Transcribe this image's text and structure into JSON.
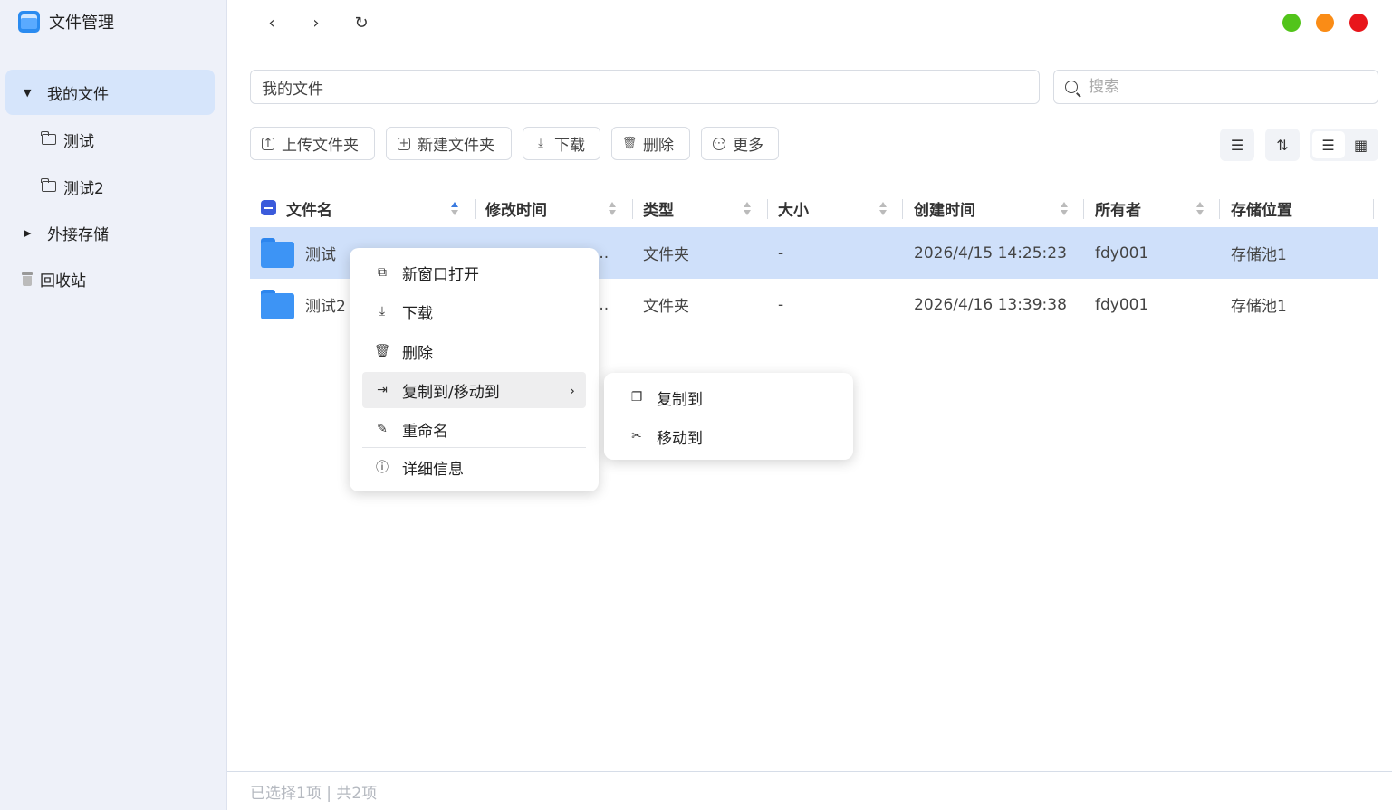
{
  "app": {
    "title": "文件管理"
  },
  "sidebar": {
    "items": [
      {
        "label": "我的文件"
      },
      {
        "label": "测试"
      },
      {
        "label": "测试2"
      },
      {
        "label": "外接存储"
      },
      {
        "label": "回收站"
      }
    ]
  },
  "nav": {
    "back": "‹",
    "forward": "›",
    "refresh": "↻"
  },
  "window": {
    "colors": {
      "minimize": "#52c41a",
      "maximize": "#fa8c16",
      "close": "#e8161b"
    }
  },
  "path": {
    "text": "我的文件"
  },
  "search": {
    "placeholder": "搜索"
  },
  "toolbar": {
    "upload_folder": "上传文件夹",
    "new_folder": "新建文件夹",
    "download": "下载",
    "delete": "删除",
    "more": "更多"
  },
  "table": {
    "columns": [
      "文件名",
      "修改时间",
      "类型",
      "大小",
      "创建时间",
      "所有者",
      "存储位置"
    ],
    "rows": [
      {
        "name": "测试",
        "modified": "...",
        "type": "文件夹",
        "size": "-",
        "created": "2026/4/15 14:25:23",
        "owner": "fdy001",
        "location": "存储池1"
      },
      {
        "name": "测试2",
        "modified": "...",
        "type": "文件夹",
        "size": "-",
        "created": "2026/4/16 13:39:38",
        "owner": "fdy001",
        "location": "存储池1"
      }
    ]
  },
  "status": {
    "text": "已选择1项 | 共2项"
  },
  "context_menu": {
    "items": [
      "新窗口打开",
      "下载",
      "删除",
      "复制到/移动到",
      "重命名",
      "详细信息"
    ],
    "submenu": [
      "复制到",
      "移动到"
    ]
  }
}
